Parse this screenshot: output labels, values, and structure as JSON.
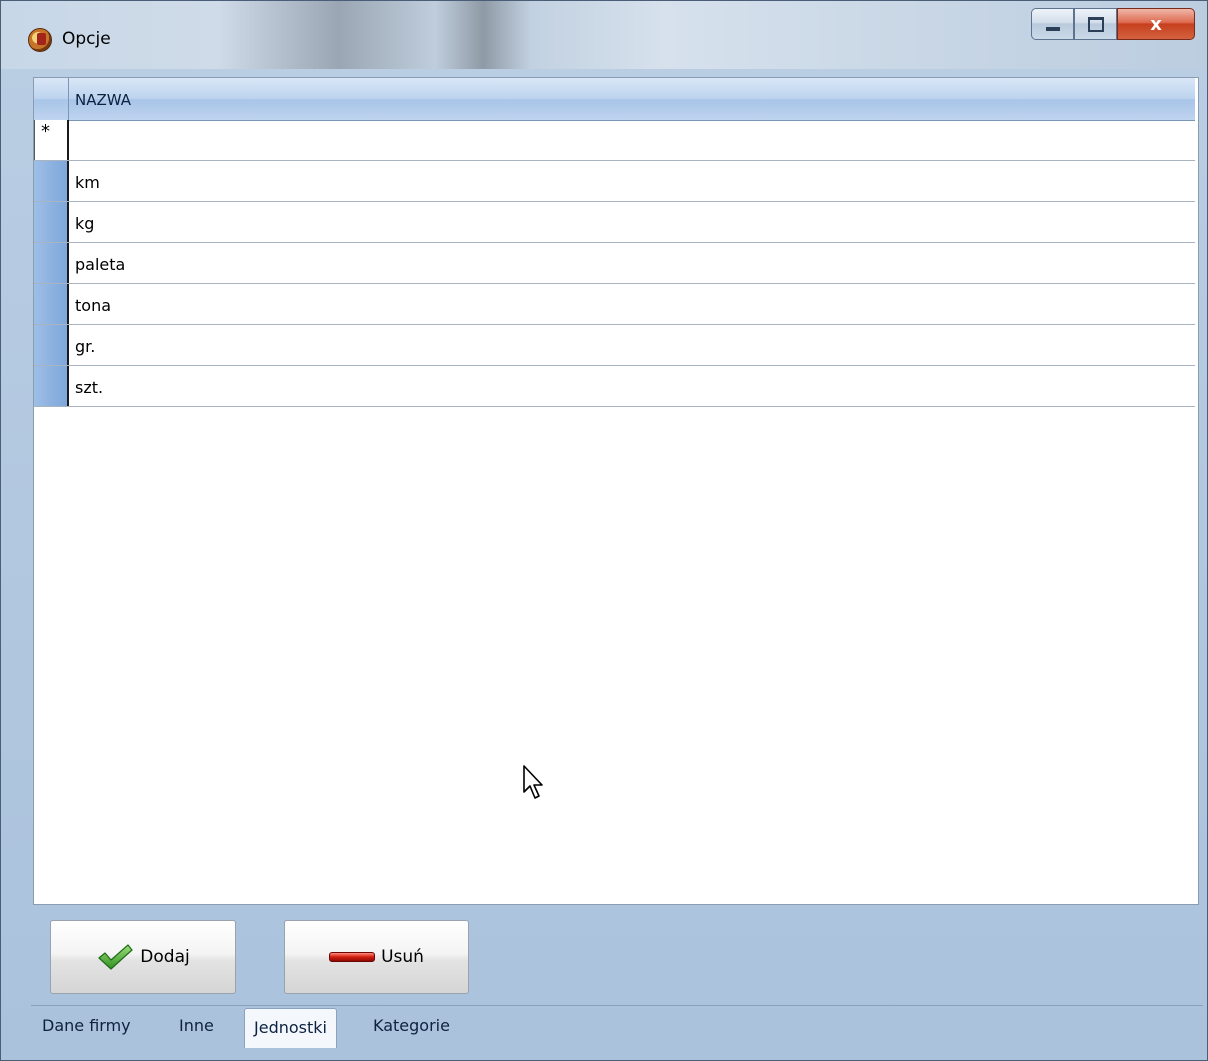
{
  "window": {
    "title": "Opcje",
    "icon": "app-logo-icon",
    "buttons": {
      "minimize": "minimize-icon",
      "maximize": "maximize-icon",
      "close": "x"
    }
  },
  "grid": {
    "columns": [
      "NAZWA"
    ],
    "new_row_marker": "*",
    "rows": [
      "km",
      "kg",
      "paleta",
      "tona",
      "gr.",
      "szt."
    ]
  },
  "toolbar": {
    "add_label": "Dodaj",
    "add_icon": "checkmark-icon",
    "delete_label": "Usuń",
    "delete_icon": "red-minus-icon"
  },
  "tabs": [
    {
      "label": "Dane firmy",
      "active": false
    },
    {
      "label": "Inne",
      "active": false
    },
    {
      "label": "Jednostki",
      "active": true
    },
    {
      "label": "Kategorie",
      "active": false
    }
  ],
  "colors": {
    "header_blue": "#bcd3ee",
    "row_header_blue": "#7ea7da",
    "window_bg": "#b9cde3",
    "delete_red": "#d11c10",
    "check_green": "#3da82e"
  }
}
